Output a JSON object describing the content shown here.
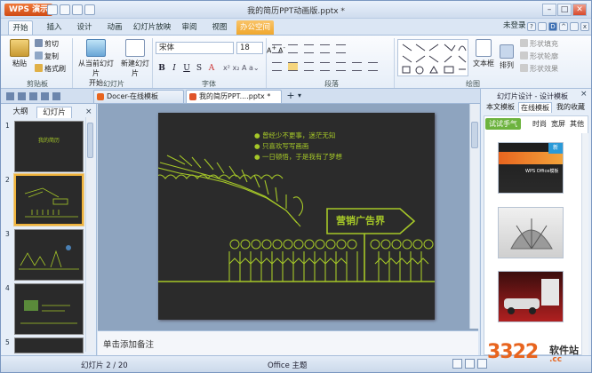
{
  "app": {
    "logo": "WPS 演示",
    "doc_title": "我的简历PPT动画版.pptx *"
  },
  "ribbon_tabs": [
    "开始",
    "插入",
    "设计",
    "动画",
    "幻灯片放映",
    "审阅",
    "视图",
    "办公空间"
  ],
  "top_right": {
    "login": "未登录"
  },
  "ribbon": {
    "clipboard": {
      "paste": "粘贴",
      "cut": "剪切",
      "copy": "复制",
      "format_painter": "格式刷",
      "label": "剪贴板"
    },
    "slides": {
      "from_current": "从当前幻灯片",
      "start": "开始",
      "new_slide": "新建幻灯片",
      "label": "幻灯片"
    },
    "font": {
      "name": "宋体",
      "size": "18",
      "label": "字体",
      "bold": "B",
      "italic": "I",
      "underline": "U",
      "strike": "S",
      "shadow": "A"
    },
    "paragraph": {
      "label": "段落"
    },
    "drawing": {
      "textbox": "文本框",
      "arrange": "排列",
      "shape_fill": "形状填充",
      "shape_outline": "形状轮廓",
      "shape_effect": "形状效果",
      "label": "绘图"
    }
  },
  "doc_tabs": [
    {
      "label": "Docer-在线模板",
      "active": false
    },
    {
      "label": "我的简历PPT....pptx *",
      "active": true
    }
  ],
  "left_pane": {
    "tabs": [
      "大纲",
      "幻灯片"
    ],
    "slides": [
      {
        "num": "1",
        "title": "我的简历"
      },
      {
        "num": "2",
        "title": ""
      },
      {
        "num": "3",
        "title": ""
      },
      {
        "num": "4",
        "title": ""
      },
      {
        "num": "5",
        "title": ""
      }
    ]
  },
  "slide": {
    "bullets": [
      "曾经少不更事，迷茫无知",
      "只喜欢写写画画",
      "一日顿悟，于是我有了梦想"
    ],
    "sign_text": "营销广告界"
  },
  "notes_placeholder": "单击添加备注",
  "right_pane": {
    "header": "幻灯片设计 - 设计模板",
    "tabs": [
      "本文模板",
      "在线模板",
      "我的收藏"
    ],
    "badge": "试试手气",
    "filters": [
      "时尚",
      "宽屏",
      "其他"
    ],
    "templates": [
      {
        "name": "WPS Office模板",
        "new": "新"
      },
      {
        "name": ""
      },
      {
        "name": ""
      }
    ]
  },
  "status": {
    "slide_info": "幻灯片 2 / 20",
    "theme": "Office 主题"
  },
  "watermark": {
    "number": "3322",
    "suffix": ".cc",
    "site": "软件站"
  },
  "colors": {
    "slide_bg": "#2b2b2b",
    "accent_green": "#a6c828",
    "ribbon_special": "#f0a72c",
    "watermark": "#e8651f"
  }
}
